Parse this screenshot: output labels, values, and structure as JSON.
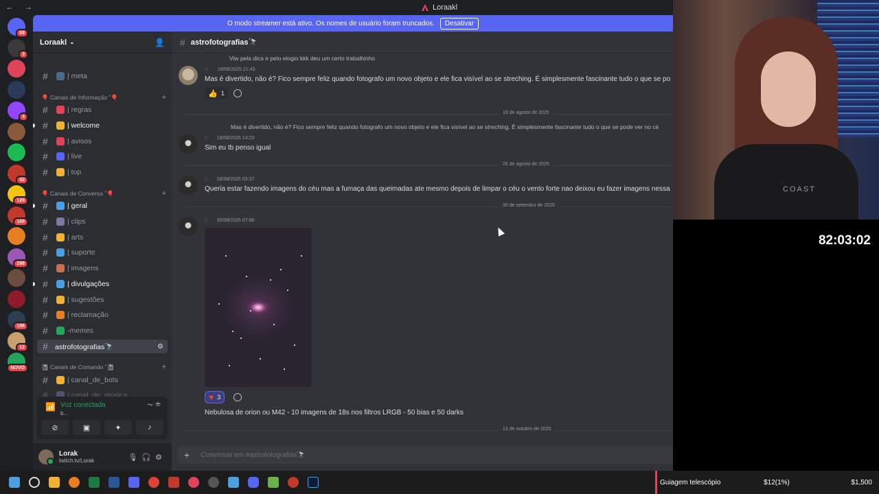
{
  "window": {
    "title": "Loraakl",
    "nav_label": "← →"
  },
  "banner": {
    "text": "O modo streamer está ativo. Os nomes de usuário foram truncados.",
    "button": "Desativar"
  },
  "servers": [
    {
      "color": "#5865f2",
      "badge": "68"
    },
    {
      "color": "#3a3a3a",
      "badge": "3"
    },
    {
      "color": "#e0445a",
      "badge": ""
    },
    {
      "color": "#2b3a5a",
      "badge": ""
    },
    {
      "color": "#9146ff",
      "badge": "4"
    },
    {
      "color": "#8a5a3a",
      "badge": ""
    },
    {
      "color": "#1db954",
      "badge": ""
    },
    {
      "color": "#c0392b",
      "badge": "42"
    },
    {
      "color": "#f1c40f",
      "badge": "128"
    },
    {
      "color": "#c0392b",
      "badge": "109"
    },
    {
      "color": "#e67e22",
      "badge": ""
    },
    {
      "color": "#9b59b6",
      "badge": "298"
    },
    {
      "color": "#6b4c3f",
      "badge": ""
    },
    {
      "color": "#8e1b2b",
      "badge": ""
    },
    {
      "color": "#2c3e50",
      "badge": "106"
    },
    {
      "color": "#c8a070",
      "badge": "12"
    },
    {
      "color": "#23a55a",
      "badge": "NOVO"
    }
  ],
  "sidebar": {
    "guild_name": "Loraakl",
    "channels": [
      {
        "label": "| meta",
        "emoji": "#4a6a8a",
        "bright": false
      },
      {
        "label": "| regras",
        "emoji": "#e0445a",
        "bright": false
      },
      {
        "label": "| welcome",
        "emoji": "#f0b232",
        "bright": true,
        "unread": true
      },
      {
        "label": "| avisos",
        "emoji": "#e0445a",
        "bright": false
      },
      {
        "label": "| live",
        "emoji": "#5865f2",
        "bright": false
      },
      {
        "label": "| top",
        "emoji": "#f0b232",
        "bright": false
      },
      {
        "label": "| geral",
        "emoji": "#4aa0e0",
        "bright": true,
        "unread": true
      },
      {
        "label": "| clips",
        "emoji": "#7a7aa0",
        "bright": false
      },
      {
        "label": "| arts",
        "emoji": "#f0b232",
        "bright": false
      },
      {
        "label": "| suporte",
        "emoji": "#4aa0e0",
        "bright": false
      },
      {
        "label": "| imagens",
        "emoji": "#c87050",
        "bright": false
      },
      {
        "label": "| divulgações",
        "emoji": "#4aa0e0",
        "bright": true,
        "unread": true
      },
      {
        "label": "| sugestões",
        "emoji": "#f0b232",
        "bright": false
      },
      {
        "label": "| reclamação",
        "emoji": "#e67e22",
        "bright": false
      },
      {
        "label": "-memes",
        "emoji": "#23a55a",
        "bright": false
      },
      {
        "label": "astrofotografias🔭",
        "emoji": "",
        "bright": true,
        "active": true
      },
      {
        "label": "| canal_de_bots",
        "emoji": "#f0b232",
        "bright": false
      },
      {
        "label": "| canal_de_música",
        "emoji": "#7a7aa0",
        "bright": false
      }
    ],
    "categories": [
      {
        "label": "🎈 Canais de Informação ˚🎈"
      },
      {
        "label": "🎈 Canais de Conversa ˚🎈"
      },
      {
        "label": "📓 Canais de Comando ˚📓"
      }
    ],
    "voice": {
      "title": "Voz conectada",
      "sub": "b..."
    },
    "user": {
      "name": "Lorak",
      "status": "twitch.tv/Lorak"
    }
  },
  "channel": {
    "name": "astrofotografias🔭",
    "composer_placeholder": "Conversar em #astrofotografias🔭"
  },
  "messages": [
    {
      "reply": "Viw pela dica e pelo elogio kkk deu um certo trabalhinho",
      "author": "H...",
      "time": "18/08/2025 21:43",
      "text": "Mas é divertido, não é? Fico sempre feliz quando fotografo um novo objeto e ele fica visível ao se streching. É simplesmente fascinante tudo o que se po",
      "reaction": "1"
    },
    {
      "divider": "19 de agosto de 2025"
    },
    {
      "reply": "Mas é divertido, não é? Fico sempre feliz quando fotografo um novo objeto e ele fica visível ao se streching. É simplesmente fascinante tudo o que se pode ver no cé",
      "author": "b...",
      "time": "19/08/2025 14:23",
      "text": "Sim eu tb penso igual"
    },
    {
      "divider": "26 de agosto de 2025"
    },
    {
      "author": "b...",
      "time": "26/08/2025 03:37",
      "text": "Queria estar fazendo imagens do céu mas a fumaça das queimadas ate mesmo depois de limpar o céu o vento forte nao deixou eu fazer imagens nessa"
    },
    {
      "divider": "30 de setembro de 2025"
    },
    {
      "author": "b...",
      "time": "30/09/2025 07:08",
      "text": "Nebulosa de orion ou M42 - 10 imagens de 18s nos filtros LRGB - 50 bias e 50 darks",
      "reaction": "3"
    },
    {
      "divider": "13 de outubro de 2025"
    }
  ],
  "stream": {
    "timer": "82:03:02",
    "shirt_text": "COAST"
  },
  "ticker": {
    "label": "Guiagem telescópio",
    "progress": "$12(1%)",
    "goal": "$1,500",
    "accent": "#e0445a"
  }
}
